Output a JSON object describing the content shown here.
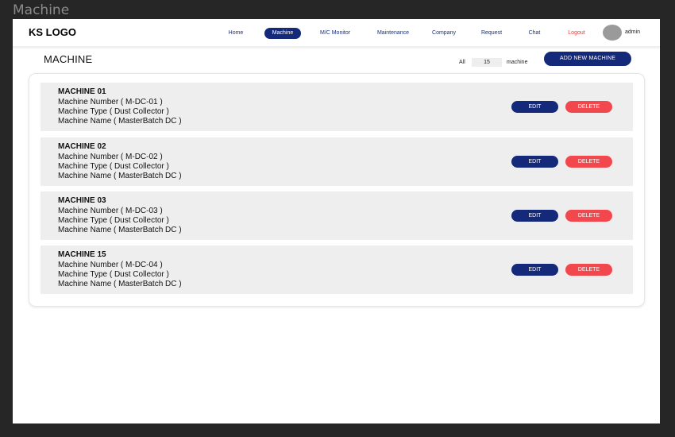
{
  "frame": {
    "title": "Machine"
  },
  "navbar": {
    "logo": "KS LOGO",
    "items": [
      {
        "label": "Home",
        "active": false
      },
      {
        "label": "Machine",
        "active": true
      },
      {
        "label": "M/C Monitor",
        "active": false
      },
      {
        "label": "Maintenance",
        "active": false
      },
      {
        "label": "Company",
        "active": false
      },
      {
        "label": "Request",
        "active": false
      },
      {
        "label": "Chat",
        "active": false
      },
      {
        "label": "Logout",
        "active": false
      }
    ],
    "user_name": "admin"
  },
  "page": {
    "title": "MACHINE",
    "count_label": "All",
    "count_value": "15",
    "count_unit": "machine",
    "add_button_label": "ADD NEW MACHINE"
  },
  "machines": [
    {
      "title": "MACHINE 01",
      "number": "Machine Number ( M-DC-01 )",
      "type": "Machine Type ( Dust Collector )",
      "name": "Machine Name ( MasterBatch DC )",
      "edit_label": "EDIT",
      "delete_label": "DELETE"
    },
    {
      "title": "MACHINE 02",
      "number": "Machine Number ( M-DC-02 )",
      "type": "Machine Type ( Dust Collector )",
      "name": "Machine Name ( MasterBatch DC )",
      "edit_label": "EDIT",
      "delete_label": "DELETE"
    },
    {
      "title": "MACHINE 03",
      "number": "Machine Number ( M-DC-03 )",
      "type": "Machine Type ( Dust Collector )",
      "name": "Machine Name ( MasterBatch DC )",
      "edit_label": "EDIT",
      "delete_label": "DELETE"
    },
    {
      "title": "MACHINE 15",
      "number": "Machine Number ( M-DC-04 )",
      "type": "Machine Type ( Dust Collector )",
      "name": "Machine Name ( MasterBatch DC )",
      "edit_label": "EDIT",
      "delete_label": "DELETE"
    }
  ],
  "colors": {
    "primary": "#14297a",
    "danger": "#f2484d",
    "card_bg": "#eeeeee",
    "frame_bg": "#262626"
  }
}
